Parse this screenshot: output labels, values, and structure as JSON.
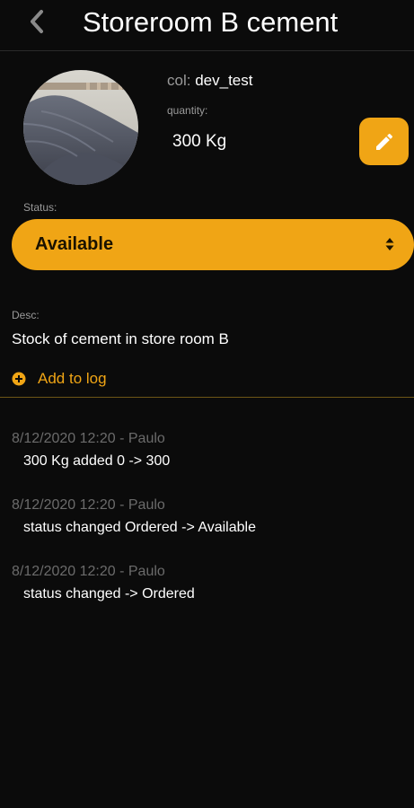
{
  "header": {
    "title": "Storeroom B cement",
    "back_icon": "chevron-left-icon"
  },
  "item": {
    "photo_alt": "pile of cement",
    "col_label": "col:",
    "col_value": "dev_test",
    "quantity_label": "quantity:",
    "quantity_value": "300 Kg",
    "edit_icon": "pencil-icon"
  },
  "status": {
    "label": "Status:",
    "selected": "Available"
  },
  "description": {
    "label": "Desc:",
    "text": "Stock of cement in store room B"
  },
  "add_log": {
    "icon": "plus-circle-icon",
    "label": "Add to log"
  },
  "log": [
    {
      "meta": "8/12/2020 12:20 - Paulo",
      "text": "300 Kg added 0 -> 300"
    },
    {
      "meta": "8/12/2020 12:20 - Paulo",
      "text": "status changed Ordered -> Available"
    },
    {
      "meta": "8/12/2020 12:20 - Paulo",
      "text": "status changed  -> Ordered"
    }
  ],
  "colors": {
    "accent": "#f0a515",
    "background": "#0b0b0b",
    "muted_text": "#9a9a9a",
    "log_meta_text": "#6b6b6b"
  }
}
